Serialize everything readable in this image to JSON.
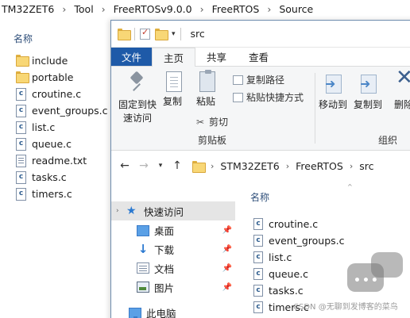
{
  "background": {
    "breadcrumb": [
      "TM32ZET6",
      "Tool",
      "FreeRTOSv9.0.0",
      "FreeRTOS",
      "Source"
    ],
    "column_header": "名称",
    "items": [
      {
        "name": "include",
        "type": "folder"
      },
      {
        "name": "portable",
        "type": "folder"
      },
      {
        "name": "croutine.c",
        "type": "c"
      },
      {
        "name": "event_groups.c",
        "type": "c"
      },
      {
        "name": "list.c",
        "type": "c"
      },
      {
        "name": "queue.c",
        "type": "c"
      },
      {
        "name": "readme.txt",
        "type": "txt"
      },
      {
        "name": "tasks.c",
        "type": "c"
      },
      {
        "name": "timers.c",
        "type": "c"
      }
    ]
  },
  "window": {
    "title": "src",
    "tabs": {
      "file": "文件",
      "home": "主页",
      "share": "共享",
      "view": "查看"
    },
    "ribbon": {
      "pin_label_1": "固定到快",
      "pin_label_2": "速访问",
      "copy": "复制",
      "paste": "粘贴",
      "copy_path": "复制路径",
      "paste_shortcut": "粘贴快捷方式",
      "cut": "剪切",
      "clipboard_group": "剪贴板",
      "move_to": "移动到",
      "copy_to": "复制到",
      "delete": "删除",
      "organize_group": "组织"
    },
    "address": [
      "STM32ZET6",
      "FreeRTOS",
      "src"
    ],
    "nav": {
      "quick_access": "快速访问",
      "desktop": "桌面",
      "downloads": "下载",
      "documents": "文档",
      "pictures": "图片",
      "this_pc": "此电脑"
    },
    "column_header": "名称",
    "files": [
      "croutine.c",
      "event_groups.c",
      "list.c",
      "queue.c",
      "tasks.c",
      "timers.c"
    ]
  },
  "watermark": "CSDN @无聊到发博客的菜鸟"
}
